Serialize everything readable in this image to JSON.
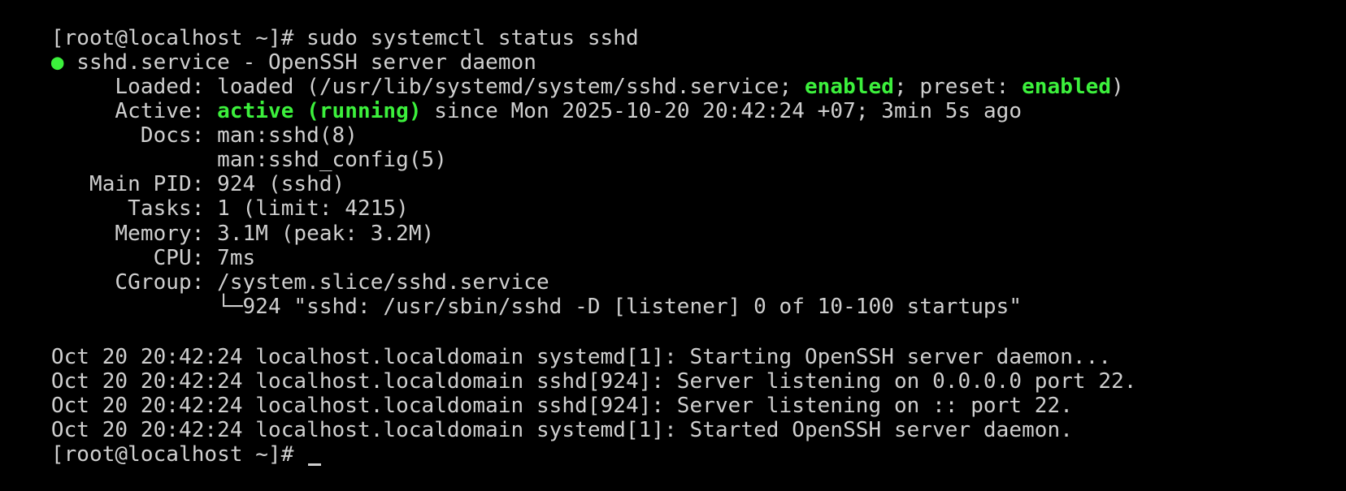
{
  "colors": {
    "background": "#000000",
    "text": "#cfcfcf",
    "highlight": "#3cf03c"
  },
  "prompt_line": "[root@localhost ~]# sudo systemctl status sshd",
  "unit": {
    "bullet": "●",
    "title": " sshd.service - OpenSSH server daemon",
    "loaded_prefix": "     Loaded: loaded (/usr/lib/systemd/system/sshd.service; ",
    "loaded_enabled": "enabled",
    "loaded_mid": "; preset: ",
    "loaded_preset": "enabled",
    "loaded_suffix": ")",
    "active_label": "     Active: ",
    "active_state": "active (running)",
    "active_since": " since Mon 2025-10-20 20:42:24 +07; 3min 5s ago",
    "docs_1": "       Docs: man:sshd(8)",
    "docs_2": "             man:sshd_config(5)",
    "main_pid": "   Main PID: 924 (sshd)",
    "tasks": "      Tasks: 1 (limit: 4215)",
    "memory": "     Memory: 3.1M (peak: 3.2M)",
    "cpu": "        CPU: 7ms",
    "cgroup": "     CGroup: /system.slice/sshd.service",
    "cgroup_child": "             └─924 \"sshd: /usr/sbin/sshd -D [listener] 0 of 10-100 startups\""
  },
  "log_lines": [
    "Oct 20 20:42:24 localhost.localdomain systemd[1]: Starting OpenSSH server daemon...",
    "Oct 20 20:42:24 localhost.localdomain sshd[924]: Server listening on 0.0.0.0 port 22.",
    "Oct 20 20:42:24 localhost.localdomain sshd[924]: Server listening on :: port 22.",
    "Oct 20 20:42:24 localhost.localdomain systemd[1]: Started OpenSSH server daemon."
  ],
  "final_prompt": "[root@localhost ~]#"
}
